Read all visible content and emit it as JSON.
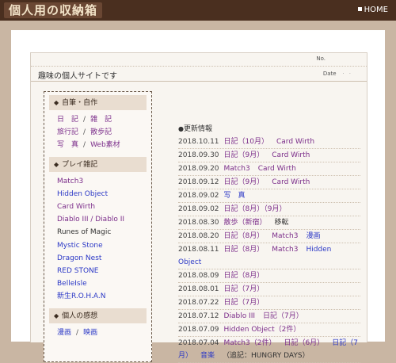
{
  "header": {
    "logo_text": "個人用の収納箱",
    "home_label": "HOME"
  },
  "panel": {
    "no_label": "No.",
    "site_title": "趣味の個人サイトです",
    "date_label": "Date"
  },
  "sidebar": {
    "sections": [
      {
        "title": "自筆・自作",
        "rows": [
          [
            {
              "text": "日　記",
              "color": "purple"
            },
            {
              "text": "雑　記",
              "color": "purple"
            }
          ],
          [
            {
              "text": "旅行記",
              "color": "purple"
            },
            {
              "text": "散歩記",
              "color": "purple"
            }
          ],
          [
            {
              "text": "写　真",
              "color": "purple"
            },
            {
              "text": "Web素材",
              "color": "purple"
            }
          ]
        ]
      },
      {
        "title": "プレイ雑記",
        "items": [
          {
            "text": "Match3",
            "color": "purple"
          },
          {
            "text": "Hidden Object",
            "color": "blue"
          },
          {
            "text": "Card Wirth",
            "color": "purple"
          },
          {
            "text": "Diablo III / Diablo II",
            "color": "purple"
          },
          {
            "text": "Runes of Magic",
            "color": "black"
          },
          {
            "text": "Mystic Stone",
            "color": "blue"
          },
          {
            "text": "Dragon Nest",
            "color": "blue"
          },
          {
            "text": "RED STONE",
            "color": "blue"
          },
          {
            "text": "BelleIsle",
            "color": "blue"
          },
          {
            "text": "新生R.O.H.A.N",
            "color": "blue"
          }
        ]
      },
      {
        "title": "個人の感想",
        "rows": [
          [
            {
              "text": "漫画",
              "color": "blue"
            },
            {
              "text": "映画",
              "color": "blue"
            }
          ]
        ]
      }
    ]
  },
  "updates": {
    "heading": "更新情報",
    "items": [
      {
        "date": "2018.10.11",
        "links": [
          {
            "text": "日記（10月）",
            "color": "purple"
          },
          {
            "text": "Card Wirth",
            "color": "purple"
          }
        ]
      },
      {
        "date": "2018.09.30",
        "links": [
          {
            "text": "日記（9月）",
            "color": "purple"
          },
          {
            "text": "Card Wirth",
            "color": "purple"
          }
        ]
      },
      {
        "date": "2018.09.20",
        "links": [
          {
            "text": "Match3",
            "color": "purple"
          },
          {
            "text": "Card Wirth",
            "color": "purple"
          }
        ]
      },
      {
        "date": "2018.09.12",
        "links": [
          {
            "text": "日記（9月）",
            "color": "purple"
          },
          {
            "text": "Card Wirth",
            "color": "purple"
          }
        ]
      },
      {
        "date": "2018.09.02",
        "links": [
          {
            "text": "写　真",
            "color": "blue"
          }
        ]
      },
      {
        "date": "2018.09.02",
        "links": [
          {
            "text": "日記（8月）（9月）",
            "color": "purple"
          }
        ]
      },
      {
        "date": "2018.08.30",
        "links": [
          {
            "text": "散歩（新宿）",
            "color": "purple"
          },
          {
            "text": "移転",
            "color": "black"
          }
        ]
      },
      {
        "date": "2018.08.20",
        "links": [
          {
            "text": "日記（8月）",
            "color": "purple"
          },
          {
            "text": "Match3",
            "color": "purple"
          },
          {
            "text": "漫画",
            "color": "blue"
          }
        ]
      },
      {
        "date": "2018.08.11",
        "links": [
          {
            "text": "日記（8月）",
            "color": "purple"
          },
          {
            "text": "Match3",
            "color": "purple"
          },
          {
            "text": "Hidden Object",
            "color": "blue"
          }
        ]
      },
      {
        "date": "2018.08.09",
        "links": [
          {
            "text": "日記（8月）",
            "color": "purple"
          }
        ]
      },
      {
        "date": "2018.08.01",
        "links": [
          {
            "text": "日記（7月）",
            "color": "purple"
          }
        ]
      },
      {
        "date": "2018.07.22",
        "links": [
          {
            "text": "日記（7月）",
            "color": "purple"
          }
        ]
      },
      {
        "date": "2018.07.12",
        "links": [
          {
            "text": "Diablo III",
            "color": "purple"
          },
          {
            "text": "日記（7月）",
            "color": "purple"
          }
        ]
      },
      {
        "date": "2018.07.09",
        "links": [
          {
            "text": "Hidden Object（2件）",
            "color": "purple"
          }
        ]
      },
      {
        "date": "2018.07.04",
        "links": [
          {
            "text": "Match3（2件）",
            "color": "purple"
          },
          {
            "text": "日記（6月）",
            "color": "purple"
          },
          {
            "text": "日記（7月）",
            "color": "blue"
          },
          {
            "text": "音楽",
            "color": "blue"
          },
          {
            "text": "（追記：HUNGRY DAYS）",
            "color": "black"
          }
        ]
      }
    ]
  },
  "colors": {
    "topbar": "#4a2f1f",
    "background": "#c9b6a3",
    "link_purple": "#7b2d8a",
    "link_blue": "#2b38c6"
  },
  "icons": {
    "section_marker": "diamond-icon",
    "heading_marker": "bullet-icon",
    "home_marker": "square-icon"
  }
}
